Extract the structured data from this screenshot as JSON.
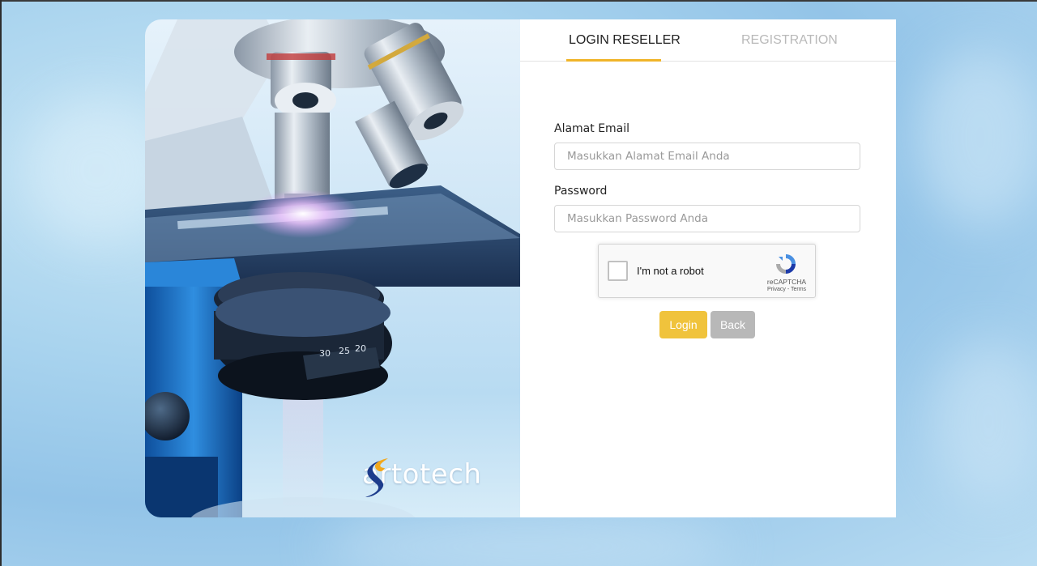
{
  "tabs": {
    "login": "LOGIN RESELLER",
    "registration": "REGISTRATION"
  },
  "form": {
    "email_label": "Alamat Email",
    "email_placeholder": "Masukkan Alamat Email Anda",
    "password_label": "Password",
    "password_placeholder": "Masukkan Password Anda"
  },
  "captcha": {
    "label": "I'm not a robot",
    "brand": "reCAPTCHA",
    "links": "Privacy - Terms"
  },
  "buttons": {
    "login": "Login",
    "back": "Back"
  },
  "hero": {
    "brand": "artotech",
    "dial_numbers": [
      "30",
      "25",
      "20"
    ],
    "icon": "microscope-image"
  },
  "colors": {
    "accent": "#f0b429",
    "login_button": "#f0c33c",
    "back_button": "#b8b8b8",
    "inactive_tab": "#b9b9b9"
  }
}
